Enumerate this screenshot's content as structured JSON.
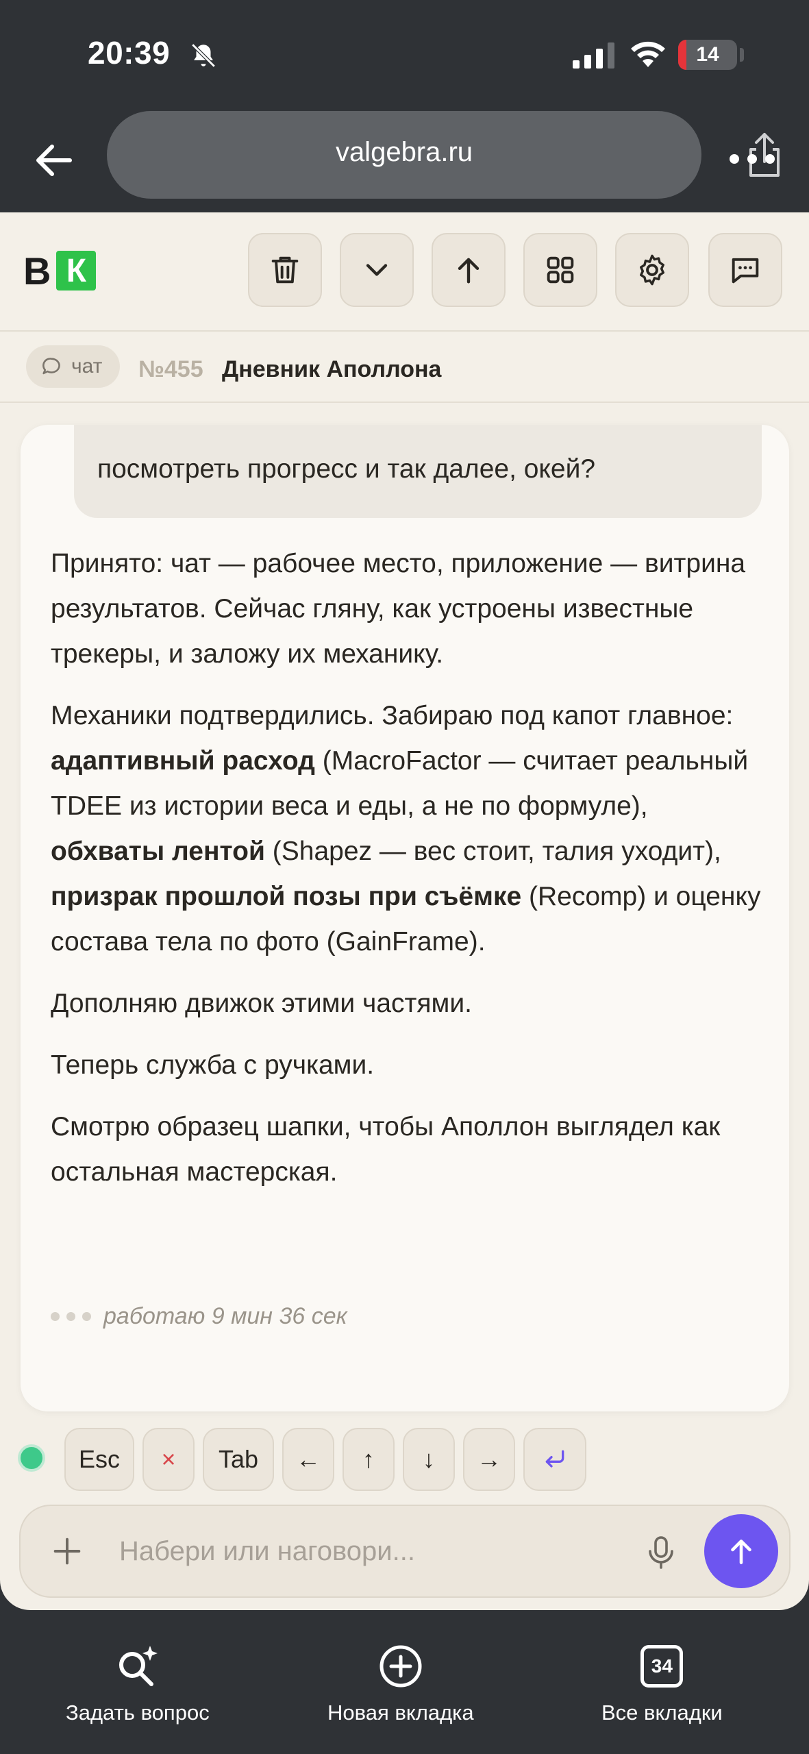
{
  "status_bar": {
    "time": "20:39",
    "battery": "14",
    "battery_fraction": 0.14,
    "colors": {
      "battery_low": "#e5343a"
    }
  },
  "browser": {
    "url": "valgebra.ru",
    "icons": [
      "back-arrow-icon",
      "share-icon",
      "more-icon"
    ]
  },
  "app": {
    "logo": {
      "letter_b": "В",
      "letter_k": "К",
      "k_color": "#2ec24a"
    },
    "toolbar_icons": [
      "trash-icon",
      "chevron-down-icon",
      "arrow-up-icon",
      "grid-icon",
      "gear-icon",
      "chat-icon"
    ],
    "breadcrumb": {
      "chip_label": "чат",
      "thread_number": "№455",
      "thread_title": "Дневник Аполлона"
    }
  },
  "conversation": {
    "user_message_visible": "посмотреть прогресс и так далее, окей?",
    "reply": {
      "p1": "Принято: чат — рабочее место, приложение — витрина результатов. Сейчас гляну, как устроены известные трекеры, и заложу их механику.",
      "p2_a": "Механики подтвердились. Забираю под капот главное: ",
      "p2_b1": "адаптивный расход",
      "p2_c": " (MacroFactor — считает реальный TDEE из истории веса и еды, а не по формуле), ",
      "p2_b2": "обхваты лентой",
      "p2_d": " (Shapez — вес стоит, талия уходит), ",
      "p2_b3": "призрак прошлой позы при съёмке",
      "p2_e": " (Recomp) и оценку состава тела по фото (GainFrame).",
      "p3": "Дополняю движок этими частями.",
      "p4": "Теперь служба с ручками.",
      "p5": "Смотрю образец шапки, чтобы Аполлон выглядел как остальная мастерская."
    },
    "working_status": "работаю 9 мин 36 сек"
  },
  "keys": {
    "esc": "Esc",
    "cancel": "×",
    "tab": "Tab",
    "left": "←",
    "up": "↑",
    "down": "↓",
    "right": "→",
    "enter_icon": "return-icon",
    "status_color": "#3ec98a"
  },
  "composer": {
    "placeholder": "Набери или наговори...",
    "value": "",
    "send_color": "#6d55f0"
  },
  "bottom_bar": {
    "ask": "Задать вопрос",
    "new_tab": "Новая вкладка",
    "all_tabs": "Все вкладки",
    "tab_count": "34"
  }
}
